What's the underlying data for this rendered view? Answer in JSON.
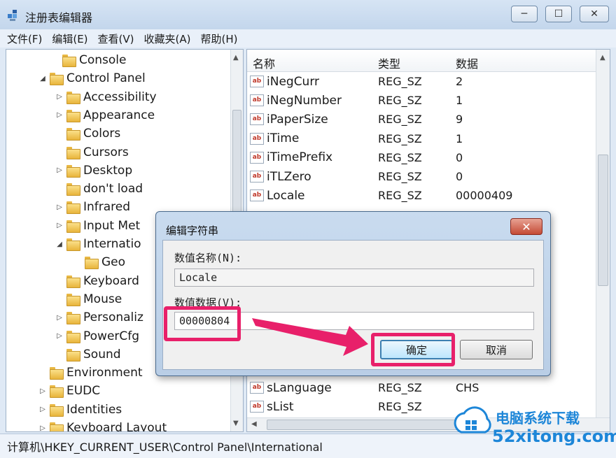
{
  "window": {
    "title": "注册表编辑器",
    "minimize_glyph": "─",
    "maximize_glyph": "☐",
    "close_glyph": "✕"
  },
  "menu": [
    "文件(F)",
    "编辑(E)",
    "查看(V)",
    "收藏夹(A)",
    "帮助(H)"
  ],
  "tree": [
    {
      "label": "Console",
      "expander": ""
    },
    {
      "label": "Control Panel",
      "expander": "◢"
    },
    {
      "label": "Accessibility",
      "expander": "▷"
    },
    {
      "label": "Appearance",
      "expander": "▷"
    },
    {
      "label": "Colors",
      "expander": ""
    },
    {
      "label": "Cursors",
      "expander": ""
    },
    {
      "label": "Desktop",
      "expander": "▷"
    },
    {
      "label": "don't load",
      "expander": ""
    },
    {
      "label": "Infrared",
      "expander": "▷"
    },
    {
      "label": "Input Met",
      "expander": "▷"
    },
    {
      "label": "Internatio",
      "expander": "◢"
    },
    {
      "label": "Geo",
      "expander": ""
    },
    {
      "label": "Keyboard",
      "expander": ""
    },
    {
      "label": "Mouse",
      "expander": ""
    },
    {
      "label": "Personaliz",
      "expander": "▷"
    },
    {
      "label": "PowerCfg",
      "expander": "▷"
    },
    {
      "label": "Sound",
      "expander": ""
    },
    {
      "label": "Environment",
      "expander": ""
    },
    {
      "label": "EUDC",
      "expander": "▷"
    },
    {
      "label": "Identities",
      "expander": "▷"
    },
    {
      "label": "Keyboard Layout",
      "expander": "▷"
    }
  ],
  "list": {
    "headers": {
      "name": "名称",
      "type": "类型",
      "data": "数据"
    },
    "icon_text": "ab",
    "rows_top": [
      {
        "name": "iNegCurr",
        "type": "REG_SZ",
        "data": "2"
      },
      {
        "name": "iNegNumber",
        "type": "REG_SZ",
        "data": "1"
      },
      {
        "name": "iPaperSize",
        "type": "REG_SZ",
        "data": "9"
      },
      {
        "name": "iTime",
        "type": "REG_SZ",
        "data": "1"
      },
      {
        "name": "iTimePrefix",
        "type": "REG_SZ",
        "data": "0"
      },
      {
        "name": "iTLZero",
        "type": "REG_SZ",
        "data": "0"
      },
      {
        "name": "Locale",
        "type": "REG_SZ",
        "data": "00000409"
      }
    ],
    "rows_bottom": [
      {
        "name": "sLanguage",
        "type": "REG_SZ",
        "data": "CHS"
      },
      {
        "name": "sList",
        "type": "REG_SZ",
        "data": ""
      }
    ]
  },
  "status": "计算机\\HKEY_CURRENT_USER\\Control Panel\\International",
  "dialog": {
    "title": "编辑字符串",
    "close_glyph": "✕",
    "name_label": "数值名称(N):",
    "name_value": "Locale",
    "data_label": "数值数据(V):",
    "data_value": "00000804",
    "ok_label": "确定",
    "cancel_label": "取消"
  },
  "annotation_color": "#e8206a",
  "watermark": {
    "line1": "电脑系统下载",
    "line2": "52xitong.com"
  }
}
